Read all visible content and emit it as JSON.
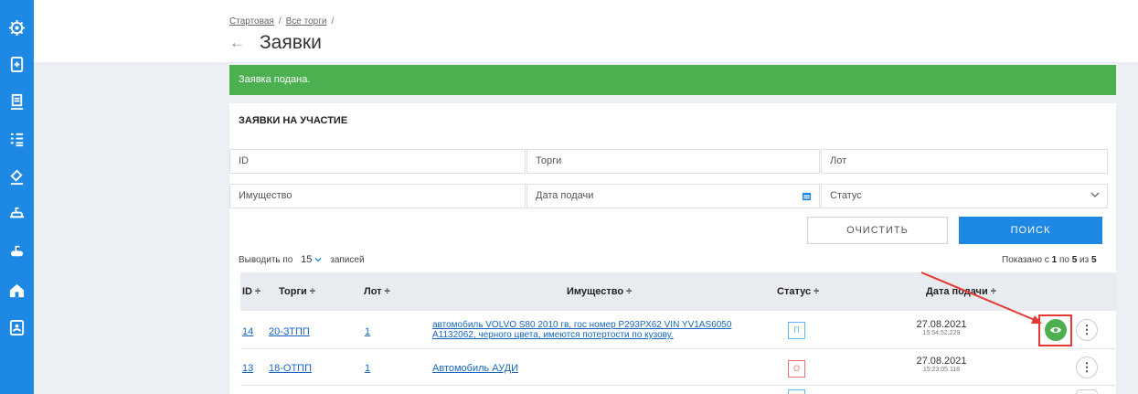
{
  "sidebar": {
    "icons": [
      "gear-icon",
      "document-icon",
      "auction-hammer-icon",
      "list-icon",
      "gavel-icon",
      "submarine-icon",
      "submarine-alt-icon",
      "house-icon",
      "contacts-icon"
    ]
  },
  "breadcrumb": {
    "home": "Стартовая",
    "all_trades": "Все торги",
    "sep": "/"
  },
  "page": {
    "back": "←",
    "title": "Заявки"
  },
  "alert": {
    "text": "Заявка подана."
  },
  "section_title": "ЗАЯВКИ НА УЧАСТИЕ",
  "filters": {
    "id_placeholder": "ID",
    "trades_placeholder": "Торги",
    "lot_placeholder": "Лот",
    "property_placeholder": "Имущество",
    "date_placeholder": "Дата подачи",
    "status_placeholder": "Статус"
  },
  "buttons": {
    "clear": "ОЧИСТИТЬ",
    "search": "ПОИСК"
  },
  "pagination": {
    "show_prefix": "Выводить по",
    "per_page": "15",
    "show_suffix": "записей",
    "shown_prefix": "Показано с",
    "from": "1",
    "mid": "по",
    "to": "5",
    "of": "из",
    "total": "5"
  },
  "table": {
    "headers": {
      "id": "ID ÷",
      "trades": "Торги ÷",
      "lot": "Лот ÷",
      "property": "Имущество ÷",
      "status": "Статус ÷",
      "date": "Дата подачи ÷"
    },
    "rows": [
      {
        "id": "14",
        "trade": "20-ЗТПП",
        "lot": "1",
        "property_line1": "автомобиль VOLVO S80 2010 гв, гос номер Р293РХ62 VIN YV1AS6050",
        "property_line2": "A1132062, черного цвета, имеются потертости по кузову.",
        "status": "П",
        "date": "27.08.2021",
        "time": "15:54:52.229"
      },
      {
        "id": "13",
        "trade": "18-ОТПП",
        "lot": "1",
        "property_line1": "Автомобиль АУДИ",
        "property_line2": "",
        "status": "О",
        "date": "27.08.2021",
        "time": "15:23:05.118"
      }
    ]
  },
  "colors": {
    "primary": "#1e88e5",
    "success": "#4caf50",
    "highlight": "#e53935",
    "status_p": "#64b5f6",
    "status_o": "#e57373"
  }
}
